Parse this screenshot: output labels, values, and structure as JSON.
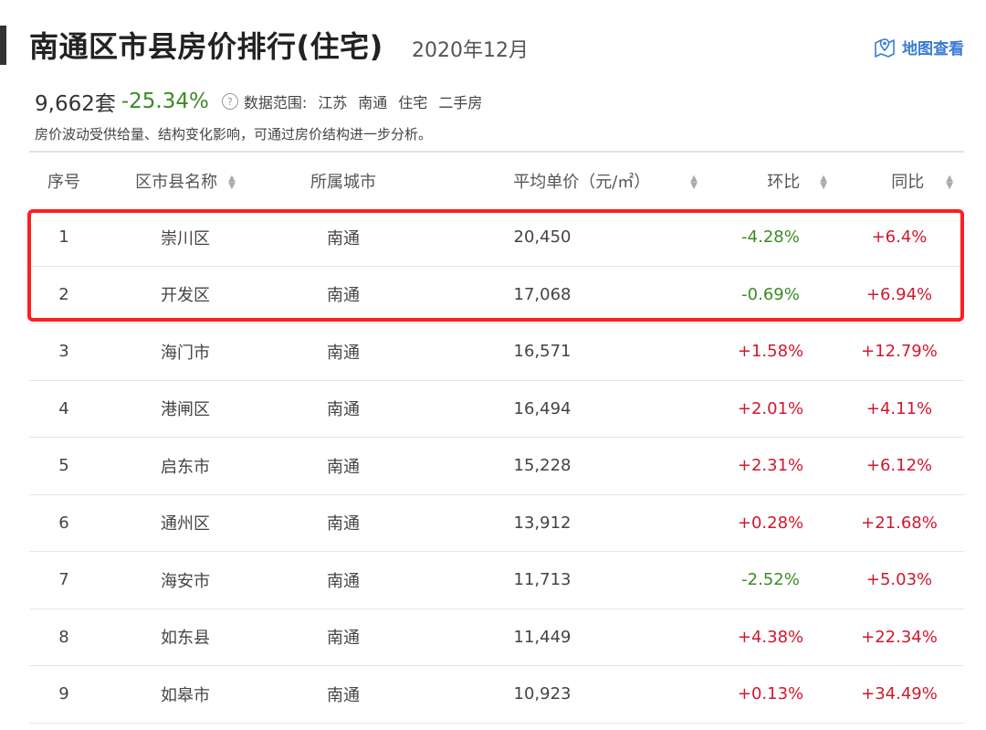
{
  "header": {
    "title": "南通区市县房价排行(住宅)",
    "period": "2020年12月",
    "map_link": "地图查看"
  },
  "stats": {
    "count": "9,662套",
    "change": "-25.34%",
    "scope_label": "数据范围:",
    "scope": [
      "江苏",
      "南通",
      "住宅",
      "二手房"
    ]
  },
  "note": "房价波动受供给量、结构变化影响，可通过房价结构进一步分析。",
  "table": {
    "columns": [
      "序号",
      "区市县名称",
      "所属城市",
      "平均单价（元/㎡）",
      "环比",
      "同比"
    ],
    "rows": [
      {
        "idx": "1",
        "name": "崇川区",
        "city": "南通",
        "price": "20,450",
        "mom": "-4.28%",
        "yoy": "+6.4%"
      },
      {
        "idx": "2",
        "name": "开发区",
        "city": "南通",
        "price": "17,068",
        "mom": "-0.69%",
        "yoy": "+6.94%"
      },
      {
        "idx": "3",
        "name": "海门市",
        "city": "南通",
        "price": "16,571",
        "mom": "+1.58%",
        "yoy": "+12.79%"
      },
      {
        "idx": "4",
        "name": "港闸区",
        "city": "南通",
        "price": "16,494",
        "mom": "+2.01%",
        "yoy": "+4.11%"
      },
      {
        "idx": "5",
        "name": "启东市",
        "city": "南通",
        "price": "15,228",
        "mom": "+2.31%",
        "yoy": "+6.12%"
      },
      {
        "idx": "6",
        "name": "通州区",
        "city": "南通",
        "price": "13,912",
        "mom": "+0.28%",
        "yoy": "+21.68%"
      },
      {
        "idx": "7",
        "name": "海安市",
        "city": "南通",
        "price": "11,713",
        "mom": "-2.52%",
        "yoy": "+5.03%"
      },
      {
        "idx": "8",
        "name": "如东县",
        "city": "南通",
        "price": "11,449",
        "mom": "+4.38%",
        "yoy": "+22.34%"
      },
      {
        "idx": "9",
        "name": "如皋市",
        "city": "南通",
        "price": "10,923",
        "mom": "+0.13%",
        "yoy": "+34.49%"
      }
    ]
  },
  "colors": {
    "negative": "#3c8a26",
    "positive": "#d0182e",
    "highlight": "#ff1f1f",
    "link": "#3a7bd5"
  },
  "icons": {
    "map": "map-pin-icon",
    "help": "question-circle-icon",
    "sort": "sort-icon"
  }
}
